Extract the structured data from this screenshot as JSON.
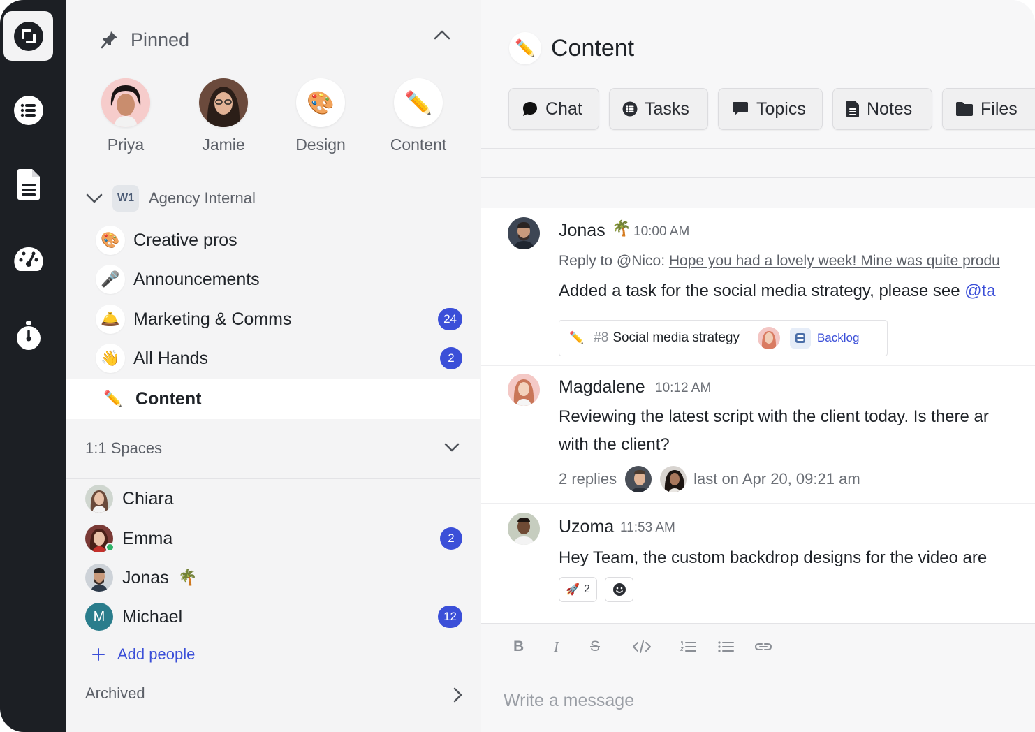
{
  "sidebar": {
    "pinned_title": "Pinned",
    "pinned": [
      {
        "label": "Priya"
      },
      {
        "label": "Jamie"
      },
      {
        "label": "Design"
      },
      {
        "label": "Content"
      }
    ],
    "workspace": {
      "badge": "W1",
      "name": "Agency Internal"
    },
    "channels": [
      {
        "icon": "🎨",
        "name": "Creative pros",
        "badge": ""
      },
      {
        "icon": "🎤",
        "name": "Announcements",
        "badge": ""
      },
      {
        "icon": "🛎️",
        "name": "Marketing & Comms",
        "badge": "24"
      },
      {
        "icon": "👋",
        "name": "All Hands",
        "badge": "2"
      },
      {
        "icon": "✏️",
        "name": "Content",
        "badge": ""
      }
    ],
    "spaces_title": "1:1 Spaces",
    "dms": [
      {
        "name": "Chiara",
        "badge": ""
      },
      {
        "name": "Emma",
        "badge": "2"
      },
      {
        "name": "Jonas",
        "emoji": "🌴",
        "badge": ""
      },
      {
        "name": "Michael",
        "initial": "M",
        "badge": "12"
      }
    ],
    "add_people": "Add people",
    "archived": "Archived"
  },
  "main": {
    "title_icon": "✏️",
    "title": "Content",
    "tabs": [
      {
        "label": "Chat",
        "icon": "chat-bubble-icon"
      },
      {
        "label": "Tasks",
        "icon": "tasks-list-icon"
      },
      {
        "label": "Topics",
        "icon": "topics-icon"
      },
      {
        "label": "Notes",
        "icon": "notes-icon"
      },
      {
        "label": "Files",
        "icon": "folder-icon"
      }
    ],
    "messages": [
      {
        "name": "Jonas",
        "emoji": "🌴",
        "time": "10:00 AM",
        "reply_prefix": "Reply to @Nico:",
        "reply_quote": "Hope you had a lovely week! Mine was quite produ",
        "text": "Added a task for the social media strategy, please see ",
        "mention": "@ta",
        "task": {
          "icon": "✏️",
          "num": "#8",
          "name": "Social media strategy",
          "status": "Backlog"
        }
      },
      {
        "name": "Magdalene",
        "time": "10:12 AM",
        "text_line1": "Reviewing the latest script with the client today. Is there ar",
        "text_line2": "with the client?",
        "replies": "2 replies",
        "last_reply": "last on Apr 20, 09:21 am"
      },
      {
        "name": "Uzoma",
        "time": "11:53 AM",
        "text": "Hey Team, the custom backdrop designs for the video are",
        "reaction_emoji": "🚀",
        "reaction_count": "2"
      }
    ],
    "composer": {
      "placeholder": "Write a message",
      "format_tools": [
        "B",
        "I",
        "S"
      ]
    }
  },
  "colors": {
    "accent": "#3b4fd8",
    "rail": "#1c1f24",
    "sidebar": "#f4f4f5"
  }
}
